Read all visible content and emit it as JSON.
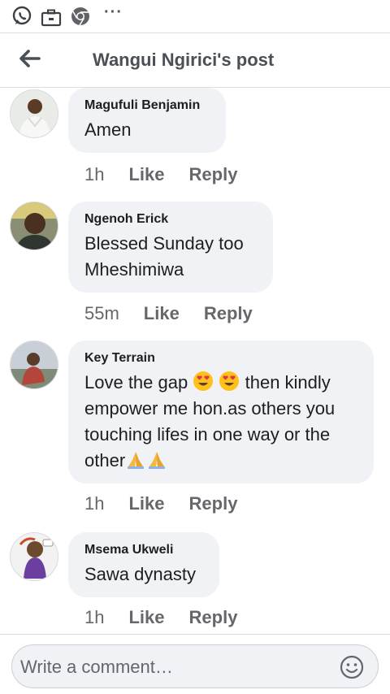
{
  "header": {
    "title": "Wangui Ngirici's post"
  },
  "comments": [
    {
      "name": "Magufuli Benjamin",
      "lines": [
        "Amen"
      ],
      "time": "1h",
      "like": "Like",
      "reply": "Reply"
    },
    {
      "name": "Ngenoh Erick",
      "lines": [
        "Blessed Sunday too",
        "Mheshimiwa"
      ],
      "time": "55m",
      "like": "Like",
      "reply": "Reply"
    },
    {
      "name": "Key Terrain",
      "lines": [
        "Love the gap",
        "then kindly",
        "empower me hon.as others you",
        "touching lifes in one way or the",
        "other"
      ],
      "time": "1h",
      "like": "Like",
      "reply": "Reply"
    },
    {
      "name": "Msema Ukweli",
      "lines": [
        "Sawa dynasty"
      ],
      "time": "1h",
      "like": "Like",
      "reply": "Reply"
    }
  ],
  "composer": {
    "placeholder": "Write a comment…"
  },
  "icons": {
    "status": [
      "whatsapp-icon",
      "briefcase-icon",
      "chrome-icon",
      "more-icon"
    ],
    "reactions": [
      "heart-eyes-emoji",
      "folded-hands-emoji"
    ]
  },
  "colors": {
    "bubble": "#f0f2f5",
    "meta": "#65676b",
    "title": "#4b4f56"
  }
}
